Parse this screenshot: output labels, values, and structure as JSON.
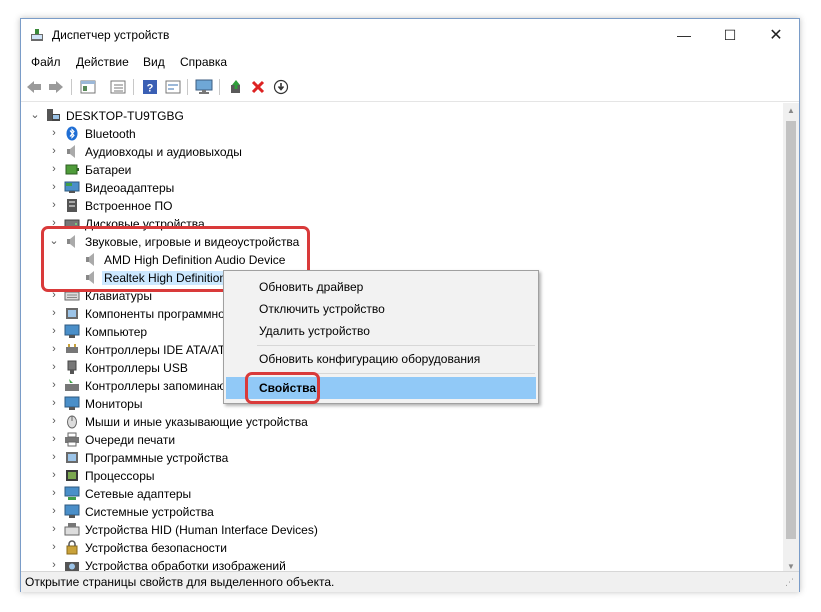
{
  "window": {
    "title": "Диспетчер устройств",
    "controls": {
      "minimize": "—",
      "maximize": "☐",
      "close": "✕"
    }
  },
  "menubar": [
    "Файл",
    "Действие",
    "Вид",
    "Справка"
  ],
  "toolbar": {
    "icons": [
      "back-icon",
      "forward-icon",
      "properties-view-icon",
      "list-view-icon",
      "help-icon",
      "action-icon",
      "monitor-scan-icon",
      "update-driver-icon",
      "uninstall-icon",
      "disable-icon"
    ]
  },
  "tree": {
    "root": "DESKTOP-TU9TGBG",
    "items": [
      {
        "label": "Bluetooth",
        "icon": "bluetooth-icon",
        "expanded": false
      },
      {
        "label": "Аудиовходы и аудиовыходы",
        "icon": "speaker-icon",
        "expanded": false
      },
      {
        "label": "Батареи",
        "icon": "battery-icon",
        "expanded": false
      },
      {
        "label": "Видеоадаптеры",
        "icon": "display-adapter-icon",
        "expanded": false
      },
      {
        "label": "Встроенное ПО",
        "icon": "firmware-icon",
        "expanded": false
      },
      {
        "label": "Дисковые устройства",
        "icon": "disk-icon",
        "expanded": false
      },
      {
        "label": "Звуковые, игровые и видеоустройства",
        "icon": "speaker-icon",
        "expanded": true,
        "children": [
          {
            "label": "AMD High Definition Audio Device",
            "icon": "speaker-icon"
          },
          {
            "label": "Realtek High Definition Audio",
            "icon": "speaker-icon",
            "selected": true
          }
        ]
      },
      {
        "label": "Клавиатуры",
        "icon": "keyboard-icon",
        "expanded": false
      },
      {
        "label": "Компоненты программного обеспечения",
        "icon": "software-component-icon",
        "expanded": false
      },
      {
        "label": "Компьютер",
        "icon": "computer-icon",
        "expanded": false
      },
      {
        "label": "Контроллеры IDE ATA/ATAPI",
        "icon": "ide-controller-icon",
        "expanded": false
      },
      {
        "label": "Контроллеры USB",
        "icon": "usb-icon",
        "expanded": false
      },
      {
        "label": "Контроллеры запоминающих устройств",
        "icon": "storage-controller-icon",
        "expanded": false
      },
      {
        "label": "Мониторы",
        "icon": "monitor-icon",
        "expanded": false
      },
      {
        "label": "Мыши и иные указывающие устройства",
        "icon": "mouse-icon",
        "expanded": false
      },
      {
        "label": "Очереди печати",
        "icon": "printer-icon",
        "expanded": false
      },
      {
        "label": "Программные устройства",
        "icon": "software-device-icon",
        "expanded": false
      },
      {
        "label": "Процессоры",
        "icon": "cpu-icon",
        "expanded": false
      },
      {
        "label": "Сетевые адаптеры",
        "icon": "network-adapter-icon",
        "expanded": false
      },
      {
        "label": "Системные устройства",
        "icon": "system-device-icon",
        "expanded": false
      },
      {
        "label": "Устройства HID (Human Interface Devices)",
        "icon": "hid-icon",
        "expanded": false
      },
      {
        "label": "Устройства безопасности",
        "icon": "security-device-icon",
        "expanded": false
      },
      {
        "label": "Устройства обработки изображений",
        "icon": "imaging-device-icon",
        "expanded": false
      }
    ]
  },
  "context_menu": {
    "items": [
      {
        "label": "Обновить драйвер"
      },
      {
        "label": "Отключить устройство"
      },
      {
        "label": "Удалить устройство"
      },
      {
        "separator": true
      },
      {
        "label": "Обновить конфигурацию оборудования"
      },
      {
        "separator": true
      },
      {
        "label": "Свойства",
        "bold": true,
        "highlighted": true
      }
    ]
  },
  "statusbar": {
    "text": "Открытие страницы свойств для выделенного объекта."
  },
  "colors": {
    "annotation": "#d93a3a",
    "selection": "#cce8ff",
    "menu_highlight": "#91c9f7"
  }
}
